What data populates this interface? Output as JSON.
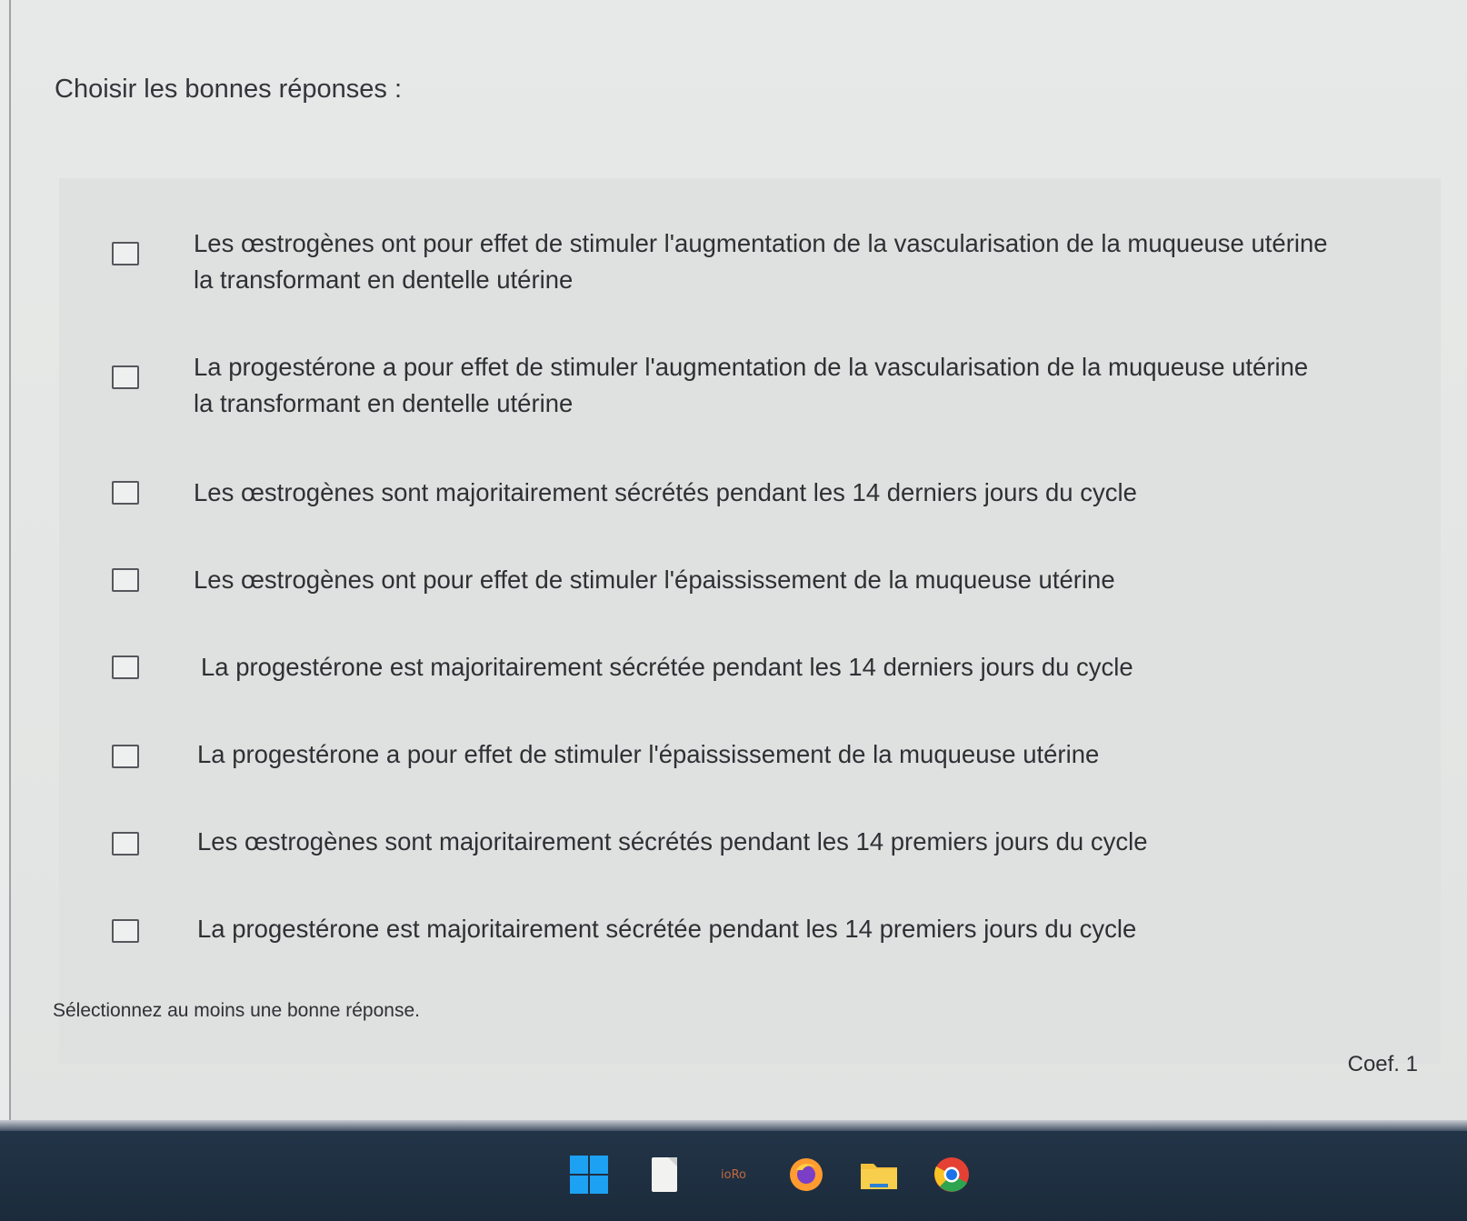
{
  "question": {
    "title": "Choisir les bonnes réponses :"
  },
  "options": [
    {
      "label": "Les œstrogènes ont pour effet de stimuler l'augmentation de la vascularisation de la muqueuse utérine la transformant en dentelle utérine",
      "checked": false
    },
    {
      "label": "La progestérone a pour effet de stimuler l'augmentation de la vascularisation de la muqueuse utérine la transformant en dentelle utérine",
      "checked": false
    },
    {
      "label": "Les œstrogènes sont majoritairement sécrétés pendant les 14 derniers jours du cycle",
      "checked": false
    },
    {
      "label": "Les œstrogènes ont pour effet de stimuler l'épaississement de la muqueuse utérine",
      "checked": false
    },
    {
      "label": "La progestérone est majoritairement sécrétée pendant les 14 derniers jours du cycle",
      "checked": false
    },
    {
      "label": "La progestérone a pour effet de stimuler l'épaississement de la muqueuse utérine",
      "checked": false
    },
    {
      "label": "Les œstrogènes sont majoritairement sécrétés pendant les 14 premiers jours du cycle",
      "checked": false
    },
    {
      "label": "La progestérone est majoritairement sécrétée pendant les 14 premiers jours du cycle",
      "checked": false
    }
  ],
  "footer": {
    "helper": "Sélectionnez au moins une bonne réponse.",
    "coef": "Coef. 1"
  },
  "taskbar": {
    "icons": [
      "windows-start-icon",
      "notes-app-icon",
      "app-logo-icon",
      "firefox-icon",
      "file-explorer-icon",
      "chrome-icon"
    ],
    "app_logo_text": "ioRo"
  },
  "colors": {
    "background": "#e9ebea",
    "panel": "#dfe1e0",
    "text": "#2e3034",
    "taskbar": "#1b2b3c",
    "windows_blue": "#1da1f2"
  }
}
